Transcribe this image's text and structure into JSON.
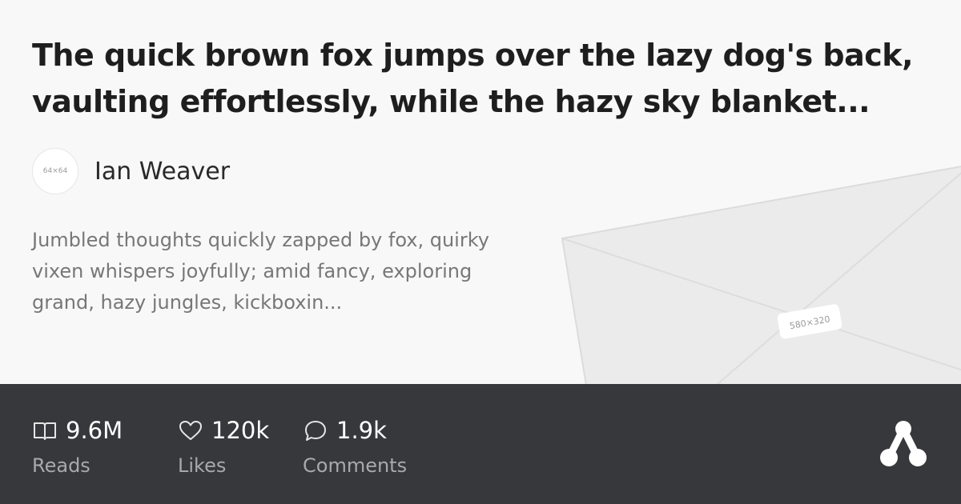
{
  "title": "The quick brown fox jumps over the lazy dog's back, vaulting effortlessly, while the hazy sky blanket...",
  "author": {
    "name": "Ian Weaver",
    "avatar_placeholder": "64×64"
  },
  "description": "Jumbled thoughts quickly zapped by fox, quirky vixen whispers joyfully; amid fancy, exploring grand, hazy jungles, kickboxin...",
  "cover": {
    "placeholder": "580×320"
  },
  "stats": [
    {
      "icon": "book-icon",
      "value": "9.6M",
      "label": "Reads"
    },
    {
      "icon": "heart-icon",
      "value": "120k",
      "label": "Likes"
    },
    {
      "icon": "comment-icon",
      "value": "1.9k",
      "label": "Comments"
    }
  ],
  "logo": {
    "icon": "share-logo-icon"
  },
  "colors": {
    "background": "#f8f8f8",
    "footer": "#37383c",
    "title": "#1e1e1e",
    "muted_text": "#777777",
    "footer_label": "#a9a9ac"
  }
}
